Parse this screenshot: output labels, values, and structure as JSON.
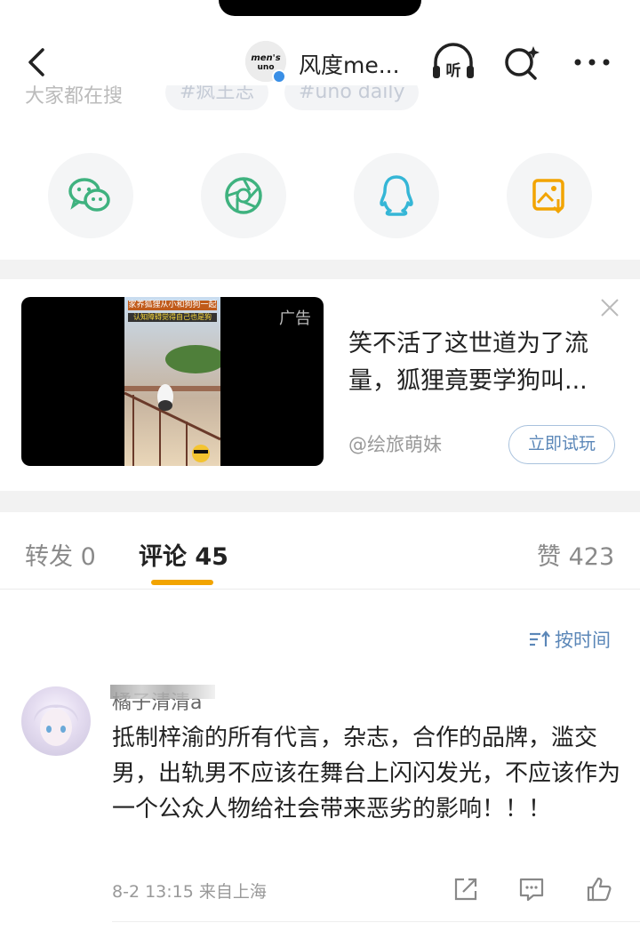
{
  "header": {
    "account_name": "风度me...",
    "avatar_text": "men's uno"
  },
  "hint": {
    "prefix": "大家都在搜",
    "chips": [
      "#疯王志",
      "#uno daily"
    ]
  },
  "share": {
    "items": [
      "wechat-icon",
      "moments-icon",
      "qq-icon",
      "save-image-icon"
    ],
    "colors": {
      "wechat": "#3fb27f",
      "moments": "#3fb27f",
      "qq": "#35b6d6",
      "save": "#f2a400"
    }
  },
  "ad": {
    "tag": "广告",
    "thumb_line1": "家养狐狸从小和狗狗一起",
    "thumb_line2": "认知障碍觉得自己也是狗",
    "title": "笑不活了这世道为了流量，狐狸竟要学狗叫...",
    "source": "@绘旅萌妹",
    "cta": "立即试玩"
  },
  "tabs": {
    "repost": "转发 0",
    "comments": "评论 45",
    "likes": "赞 423",
    "accent": "#f2a400"
  },
  "sort": {
    "label": "按时间"
  },
  "comment": {
    "username": "橘子清清a",
    "text": "抵制梓渝的所有代言，杂志，合作的品牌，滥交男，出轨男不应该在舞台上闪闪发光，不应该作为一个公众人物给社会带来恶劣的影响！！！",
    "meta": "8-2 13:15  来自上海"
  }
}
